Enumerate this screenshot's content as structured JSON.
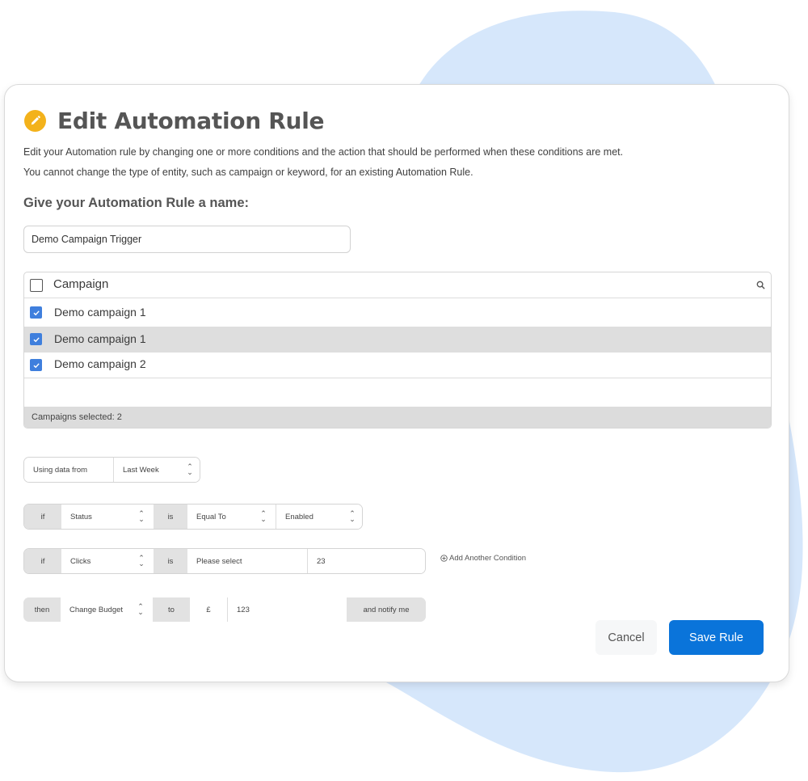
{
  "dialog": {
    "title": "Edit Automation Rule",
    "title_icon": "pencil-icon",
    "description_line1": "Edit your Automation rule by changing one or more conditions and the action that should be performed when these conditions are met.",
    "description_line2": "You cannot change the type of entity, such as campaign or keyword, for an existing Automation Rule.",
    "name_label": "Give your Automation Rule a name:",
    "name_value": "Demo Campaign Trigger"
  },
  "campaigns": {
    "header": "Campaign",
    "search_icon": "search-icon",
    "rows": [
      {
        "label": "Demo campaign 1",
        "checked": true,
        "highlighted": false
      },
      {
        "label": "Demo campaign 1",
        "checked": true,
        "highlighted": true
      },
      {
        "label": "Demo campaign 2",
        "checked": true,
        "highlighted": false
      }
    ],
    "footer": "Campaigns selected: 2"
  },
  "data_range": {
    "label": "Using data from",
    "value": "Last Week"
  },
  "condition1": {
    "if": "if",
    "field": "Status",
    "is": "is",
    "operator": "Equal To",
    "value": "Enabled"
  },
  "condition2": {
    "if": "if",
    "field": "Clicks",
    "is": "is",
    "operator": "Please select",
    "value": "23"
  },
  "add_condition": "Add Another Condition",
  "action": {
    "then": "then",
    "type": "Change Budget",
    "to": "to",
    "currency": "£",
    "value": "123",
    "notify": "and notify me"
  },
  "buttons": {
    "cancel": "Cancel",
    "save": "Save Rule"
  },
  "colors": {
    "accent": "#0a74da",
    "checkbox": "#3f7fdd",
    "title_icon": "#f3b21b",
    "blob": "#d6e7fb"
  }
}
